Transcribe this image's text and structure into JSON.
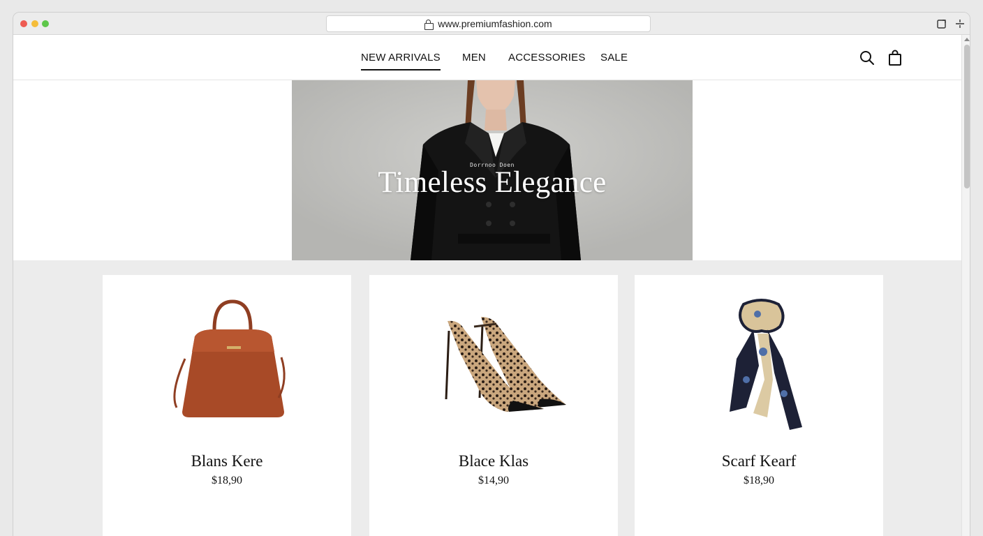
{
  "browser": {
    "url": "www.premiumfashion.com"
  },
  "nav": {
    "items": [
      {
        "label": "NEW ARRIVALS",
        "active": true
      },
      {
        "label": "MEN",
        "active": false
      },
      {
        "label": "ACCESSORIES",
        "active": false
      },
      {
        "label": "SALE",
        "active": false
      }
    ]
  },
  "header_icons": [
    "search-icon",
    "shopping-bag-icon"
  ],
  "hero": {
    "kicker": "Dorrnoo Doen",
    "title": "Timeless Elegance",
    "image": "model in black trench coat"
  },
  "products": [
    {
      "name": "Blans Kere",
      "price": "$18,90",
      "image": "brown leather handbag"
    },
    {
      "name": "Blace Klas",
      "price": "$14,90",
      "image": "leopard print pointed heels"
    },
    {
      "name": "Scarf Kearf",
      "price": "$18,90",
      "image": "printed silk scarf"
    }
  ],
  "colors": {
    "accent": "#111111",
    "background": "#ececec",
    "card": "#ffffff"
  }
}
